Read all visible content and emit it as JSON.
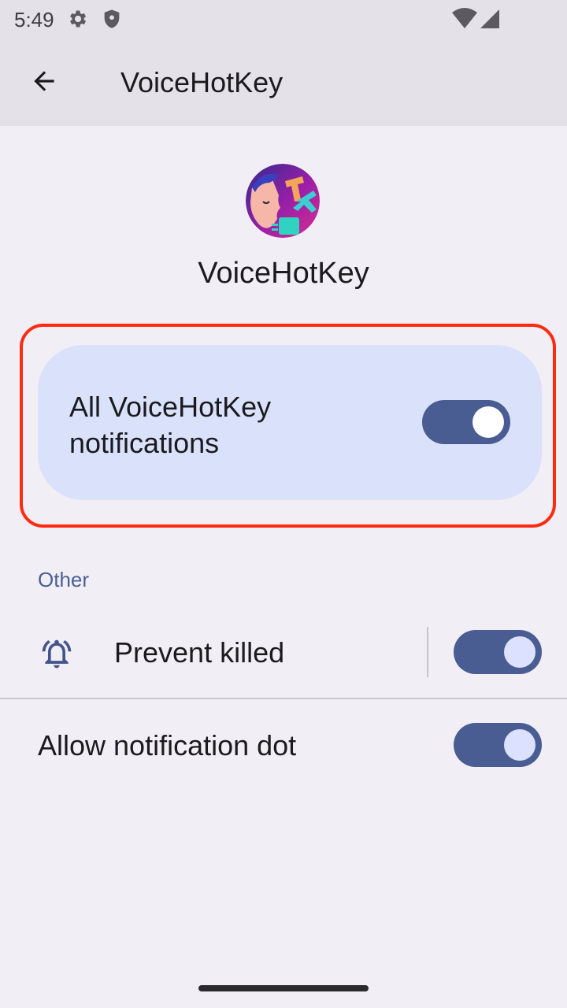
{
  "status_bar": {
    "time": "5:49",
    "icons": [
      "gear-icon",
      "shield-icon",
      "wifi-icon",
      "signal-icon"
    ]
  },
  "app_bar": {
    "back_icon": "arrow-back-icon",
    "title": "VoiceHotKey"
  },
  "app_header": {
    "icon": "app-logo-icon",
    "name": "VoiceHotKey"
  },
  "master_toggle": {
    "label": "All VoiceHotKey notifications",
    "enabled": true
  },
  "sections": [
    {
      "header": "Other",
      "items": [
        {
          "label": "Prevent killed",
          "icon": "bell-ringing-icon",
          "enabled": true
        }
      ]
    }
  ],
  "notification_dot": {
    "label": "Allow notification dot",
    "enabled": true
  },
  "colors": {
    "accent": "#495d92",
    "card_background": "#dae1fb",
    "highlight_frame": "#ff2a12",
    "page_background": "#f1eff5",
    "bar_background": "#e4e2e8"
  }
}
